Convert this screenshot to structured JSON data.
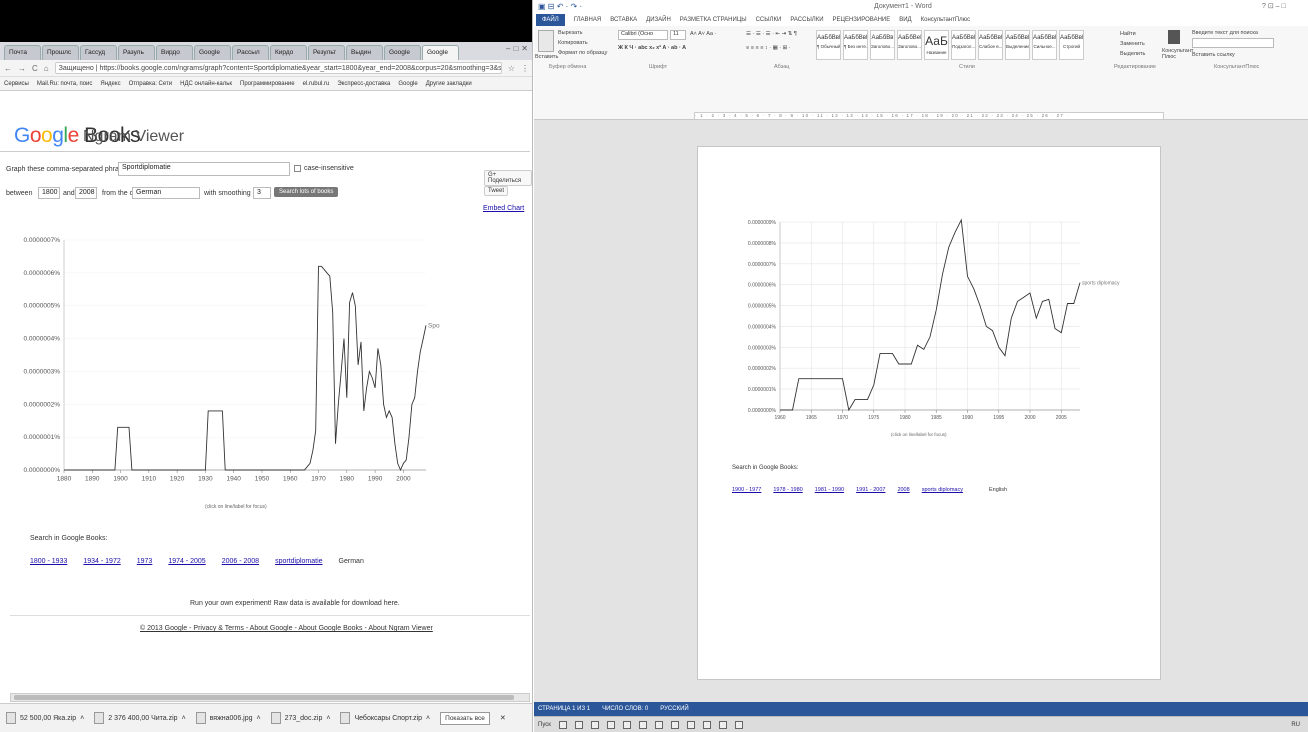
{
  "browser": {
    "tabs": [
      "Почта",
      "Прошлс",
      "Гассуд",
      "Разуль",
      "Вирдо",
      "Google",
      "Рассыл",
      "Кирдо",
      "Результ",
      "Выдин",
      "Google",
      "Google"
    ],
    "url": "Защищено | https://books.google.com/ngrams/graph?content=Sportdiplomatie&year_start=1800&year_end=2008&corpus=20&smoothing=3&share=&direct_url=t1",
    "bookmarks": [
      "Сервисы",
      "Mail.Ru: почта, поис",
      "Яндекс",
      "Отправка: Сети",
      "НДС онлайн-кальк",
      "Программирование",
      "el.rubul.ru",
      "Экспресс-доставка",
      "Google",
      "Другие закладки"
    ]
  },
  "ngram": {
    "title_main": "Books",
    "title_sub": "Ngram Viewer",
    "phrases_label": "Graph these comma-separated phrases:",
    "phrases_value": "Sportdiplomatie",
    "case_label": "case-insensitive",
    "between_label": "between",
    "year_start": "1800",
    "and_label": "and",
    "year_end": "2008",
    "corpus_label": "from the corpus",
    "corpus_value": "German",
    "smoothing_label": "with smoothing of",
    "smoothing_value": "3",
    "search_button": "Search lots of books",
    "share_g": "G+ Поделиться",
    "share_tw": "Tweet",
    "embed": "Embed Chart",
    "click_note": "(click on line/label for focus)",
    "search_in": "Search in Google Books:",
    "ranges": [
      "1800 - 1933",
      "1934 - 1972",
      "1973",
      "1974 - 2005",
      "2006 - 2008",
      "sportdiplomatie",
      "German"
    ],
    "experiment": "Run your own experiment! Raw data is available for download here.",
    "footer": "© 2013 Google - Privacy & Terms - About Google - About Google Books - About Ngram Viewer"
  },
  "downloads": [
    "52 500,00 Яка.zip",
    "2 376 400,00 Чита.zip",
    "вяжна006.jpg",
    "273_doc.zip",
    "Чебоксары Спорт.zip"
  ],
  "downloads_showall": "Показать все",
  "word": {
    "title": "Документ1 - Word",
    "menu": [
      "ФАЙЛ",
      "ГЛАВНАЯ",
      "ВСТАВКА",
      "ДИЗАЙН",
      "РАЗМЕТКА СТРАНИЦЫ",
      "ССЫЛКИ",
      "РАССЫЛКИ",
      "РЕЦЕНЗИРОВАНИЕ",
      "ВИД",
      "КонсультантПлюс"
    ],
    "paste": "Вставить",
    "cut": "Вырезать",
    "copy": "Копировать",
    "format": "Формат по образцу",
    "clipboard": "Буфер обмена",
    "font_name": "Calibri (Осно",
    "font_size": "11",
    "font_group": "Шрифт",
    "para_group": "Абзац",
    "styles_group": "Стили",
    "styles": [
      "АаБбВвГг",
      "АаБбВвГг",
      "АаБбВв",
      "АаБбВеГ",
      "АаБ",
      "АаБбВвГ",
      "АаБбВвГ",
      "АаБбВвГ",
      "АаБбВвГ",
      "АаБбВвГг"
    ],
    "style_names": [
      "¶ Обычный",
      "¶ Без инте...",
      "Заголово...",
      "Заголово...",
      "Название",
      "Подзагол...",
      "Слабое в...",
      "Выделение",
      "Сильное...",
      "Строгий"
    ],
    "find": "Найти",
    "replace": "Заменить",
    "select": "Выделить",
    "edit_group": "Редактирование",
    "consult": "Консультант Плюс",
    "consult_group": "КонсультантПлюс",
    "consult_search": "Введите текст для поиска",
    "consult_insert": "Вставить ссылку",
    "click_note": "(click on line/label for focus)",
    "search_in": "Search in Google Books:",
    "ranges": [
      "1900 - 1977",
      "1978 - 1980",
      "1981 - 1990",
      "1991 - 2007",
      "2008",
      "sports diplomacy",
      "English"
    ],
    "status": [
      "СТРАНИЦА 1 ИЗ 1",
      "ЧИСЛО СЛОВ: 0",
      "РУССКИЙ"
    ],
    "taskbar": [
      "Пуск",
      "RU"
    ]
  },
  "chart_data": [
    {
      "type": "line",
      "xlim": [
        1880,
        2008
      ],
      "ylim": [
        0,
        7e-07
      ],
      "x_ticks": [
        "1880",
        "1890",
        "1900",
        "1910",
        "1920",
        "1930",
        "1940",
        "1950",
        "1960",
        "1970",
        "1980",
        "1990",
        "2000"
      ],
      "y_ticks": [
        "0.0000000%",
        "0.0000001%",
        "0.0000002%",
        "0.0000003%",
        "0.0000004%",
        "0.0000005%",
        "0.0000006%",
        "0.0000007%"
      ],
      "series": [
        {
          "name": "Sportdiplomatie",
          "x": [
            1880,
            1897,
            1898,
            1899,
            1900,
            1901,
            1902,
            1903,
            1904,
            1930,
            1931,
            1932,
            1933,
            1934,
            1935,
            1936,
            1937,
            1938,
            1965,
            1966,
            1967,
            1968,
            1969,
            1970,
            1971,
            1972,
            1973,
            1974,
            1975,
            1976,
            1977,
            1978,
            1979,
            1980,
            1981,
            1982,
            1983,
            1984,
            1985,
            1986,
            1987,
            1988,
            1989,
            1990,
            1991,
            1992,
            1993,
            1994,
            1995,
            1996,
            1997,
            1998,
            1999,
            2000,
            2001,
            2002,
            2003,
            2004,
            2005,
            2006,
            2007,
            2008
          ],
          "y": [
            0,
            0,
            0,
            1.3e-07,
            1.3e-07,
            1.3e-07,
            1.3e-07,
            1.3e-07,
            0,
            0,
            1.8e-07,
            1.8e-07,
            1.8e-07,
            1.8e-07,
            1.8e-07,
            1.8e-07,
            0,
            0,
            0,
            1e-08,
            2e-08,
            6e-08,
            1.2e-07,
            6.2e-07,
            6.2e-07,
            6.1e-07,
            6e-07,
            5.9e-07,
            4.8e-07,
            8e-08,
            2e-07,
            3e-07,
            4e-07,
            2.2e-07,
            5.1e-07,
            5.4e-07,
            5e-07,
            3.2e-07,
            3.9e-07,
            1.8e-07,
            2.5e-07,
            3e-07,
            2.8e-07,
            2.5e-07,
            3.7e-07,
            3.2e-07,
            2e-07,
            1.6e-07,
            1.8e-07,
            1.6e-07,
            8e-08,
            2e-08,
            0,
            2e-08,
            3e-08,
            1e-07,
            2e-07,
            2.2e-07,
            3e-07,
            3.6e-07,
            4e-07,
            4.4e-07
          ]
        }
      ]
    },
    {
      "type": "line",
      "xlim": [
        1960,
        2008
      ],
      "ylim": [
        0,
        9e-07
      ],
      "x_ticks": [
        "1960",
        "1965",
        "1970",
        "1975",
        "1980",
        "1985",
        "1990",
        "1995",
        "2000",
        "2005"
      ],
      "y_ticks": [
        "0.0000000%",
        "0.0000001%",
        "0.0000002%",
        "0.0000003%",
        "0.0000004%",
        "0.0000005%",
        "0.0000006%",
        "0.0000007%",
        "0.0000008%",
        "0.0000009%"
      ],
      "series": [
        {
          "name": "sports diplomacy",
          "x": [
            1960,
            1962,
            1963,
            1964,
            1965,
            1966,
            1967,
            1968,
            1969,
            1970,
            1971,
            1972,
            1973,
            1974,
            1975,
            1976,
            1977,
            1978,
            1979,
            1980,
            1981,
            1982,
            1983,
            1984,
            1985,
            1986,
            1987,
            1988,
            1989,
            1990,
            1991,
            1992,
            1993,
            1994,
            1995,
            1996,
            1997,
            1998,
            1999,
            2000,
            2001,
            2002,
            2003,
            2004,
            2005,
            2006,
            2007,
            2008
          ],
          "y": [
            0,
            0,
            1.5e-07,
            1.5e-07,
            1.5e-07,
            1.5e-07,
            1.5e-07,
            1.5e-07,
            1.5e-07,
            1.5e-07,
            0,
            5e-08,
            5e-08,
            5e-08,
            1.2e-07,
            2.7e-07,
            2.7e-07,
            2.7e-07,
            2.2e-07,
            2.2e-07,
            2.2e-07,
            3.1e-07,
            2.9e-07,
            3.5e-07,
            4.8e-07,
            6.5e-07,
            7.8e-07,
            8.5e-07,
            9.1e-07,
            6.4e-07,
            5.8e-07,
            5e-07,
            4e-07,
            3.8e-07,
            3e-07,
            2.6e-07,
            4.4e-07,
            5.2e-07,
            5.4e-07,
            5.6e-07,
            4.4e-07,
            5.2e-07,
            5.3e-07,
            3.9e-07,
            3.7e-07,
            5.1e-07,
            5.1e-07,
            6.1e-07
          ]
        }
      ]
    }
  ]
}
